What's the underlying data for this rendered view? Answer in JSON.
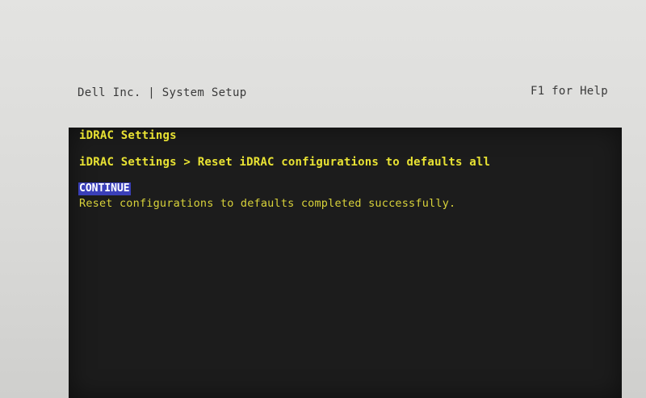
{
  "header": {
    "left_text": "Dell Inc. | System Setup",
    "help_text": "F1 for Help"
  },
  "screen": {
    "title": "iDRAC Settings",
    "breadcrumb": "iDRAC Settings > Reset iDRAC configurations to defaults all",
    "continue_label": "CONTINUE",
    "message": "Reset configurations to defaults completed successfully."
  },
  "colors": {
    "text_yellow": "#e8e233",
    "highlight_blue": "#3a3fb8",
    "screen_bg": "#1c1c1c",
    "header_bg": "#dcdcda"
  }
}
